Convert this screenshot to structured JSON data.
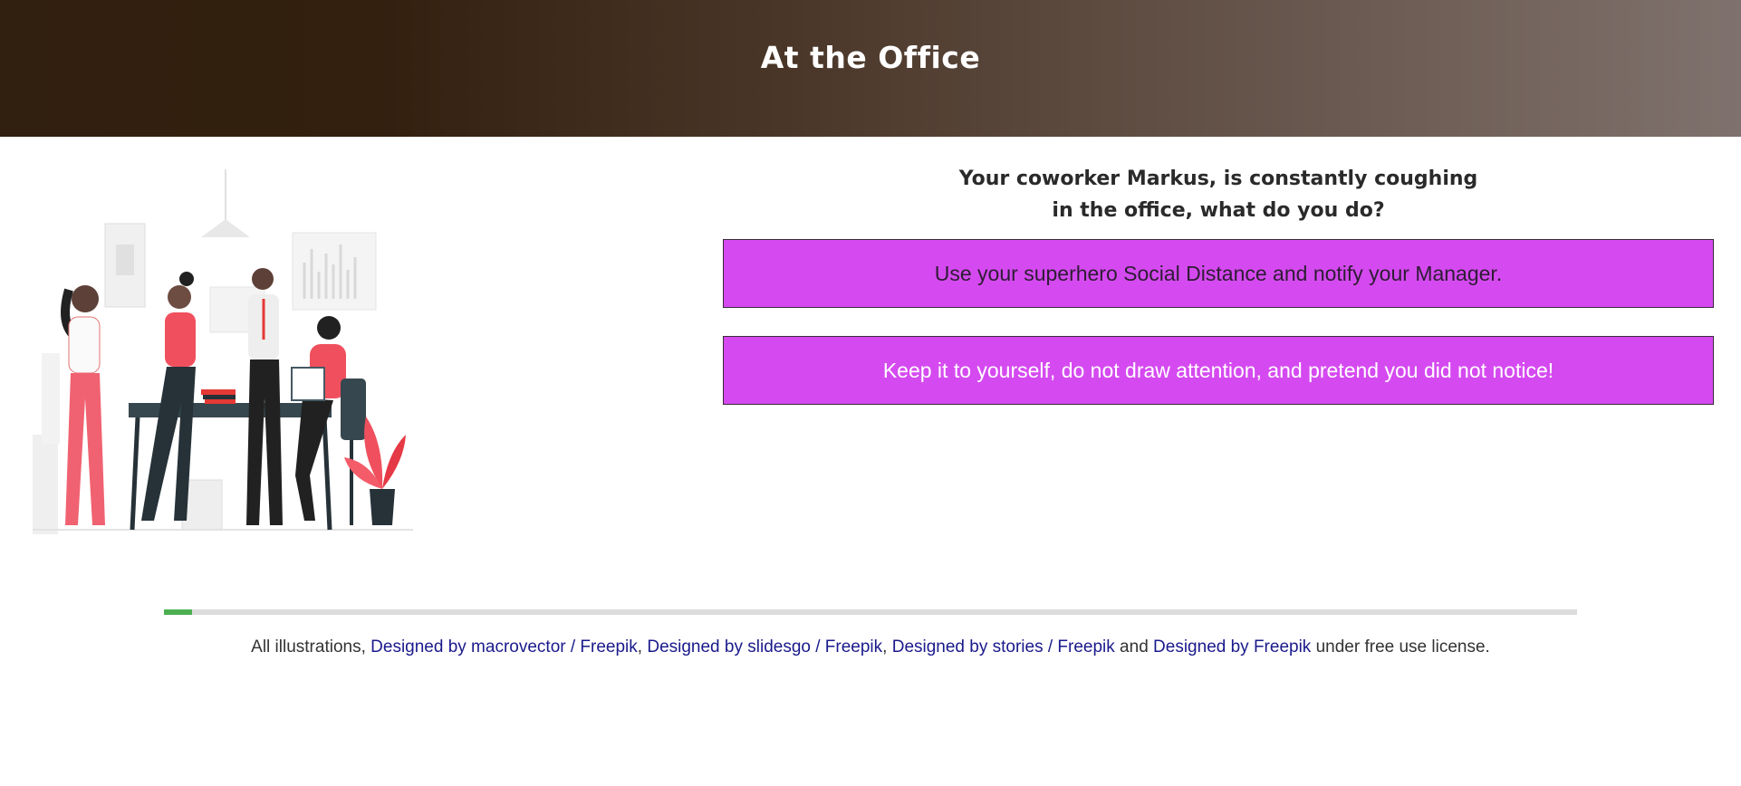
{
  "header": {
    "title": "At the Office"
  },
  "question": {
    "line1": "Your coworker Markus, is constantly coughing",
    "line2": "in the office, what do you do?"
  },
  "choices": [
    {
      "label": "Use your superhero Social Distance and notify your Manager."
    },
    {
      "label": "Keep it to yourself, do not draw attention, and pretend you did not notice!"
    }
  ],
  "progress": {
    "fraction": 0.02
  },
  "footer": {
    "prefix": "All illustrations, ",
    "link1": "Designed by macrovector / Freepik",
    "sep1": ", ",
    "link2": "Designed by slidesgo / Freepik",
    "sep2": ", ",
    "link3": "Designed by stories / Freepik",
    "and": " and ",
    "link4": "Designed by Freepik",
    "suffix": " under free use license."
  },
  "colors": {
    "choice_bg": "#d54af0",
    "progress": "#4caf50",
    "link": "#1a1a8c"
  },
  "icons": {
    "illustration": "office-team-illustration"
  }
}
